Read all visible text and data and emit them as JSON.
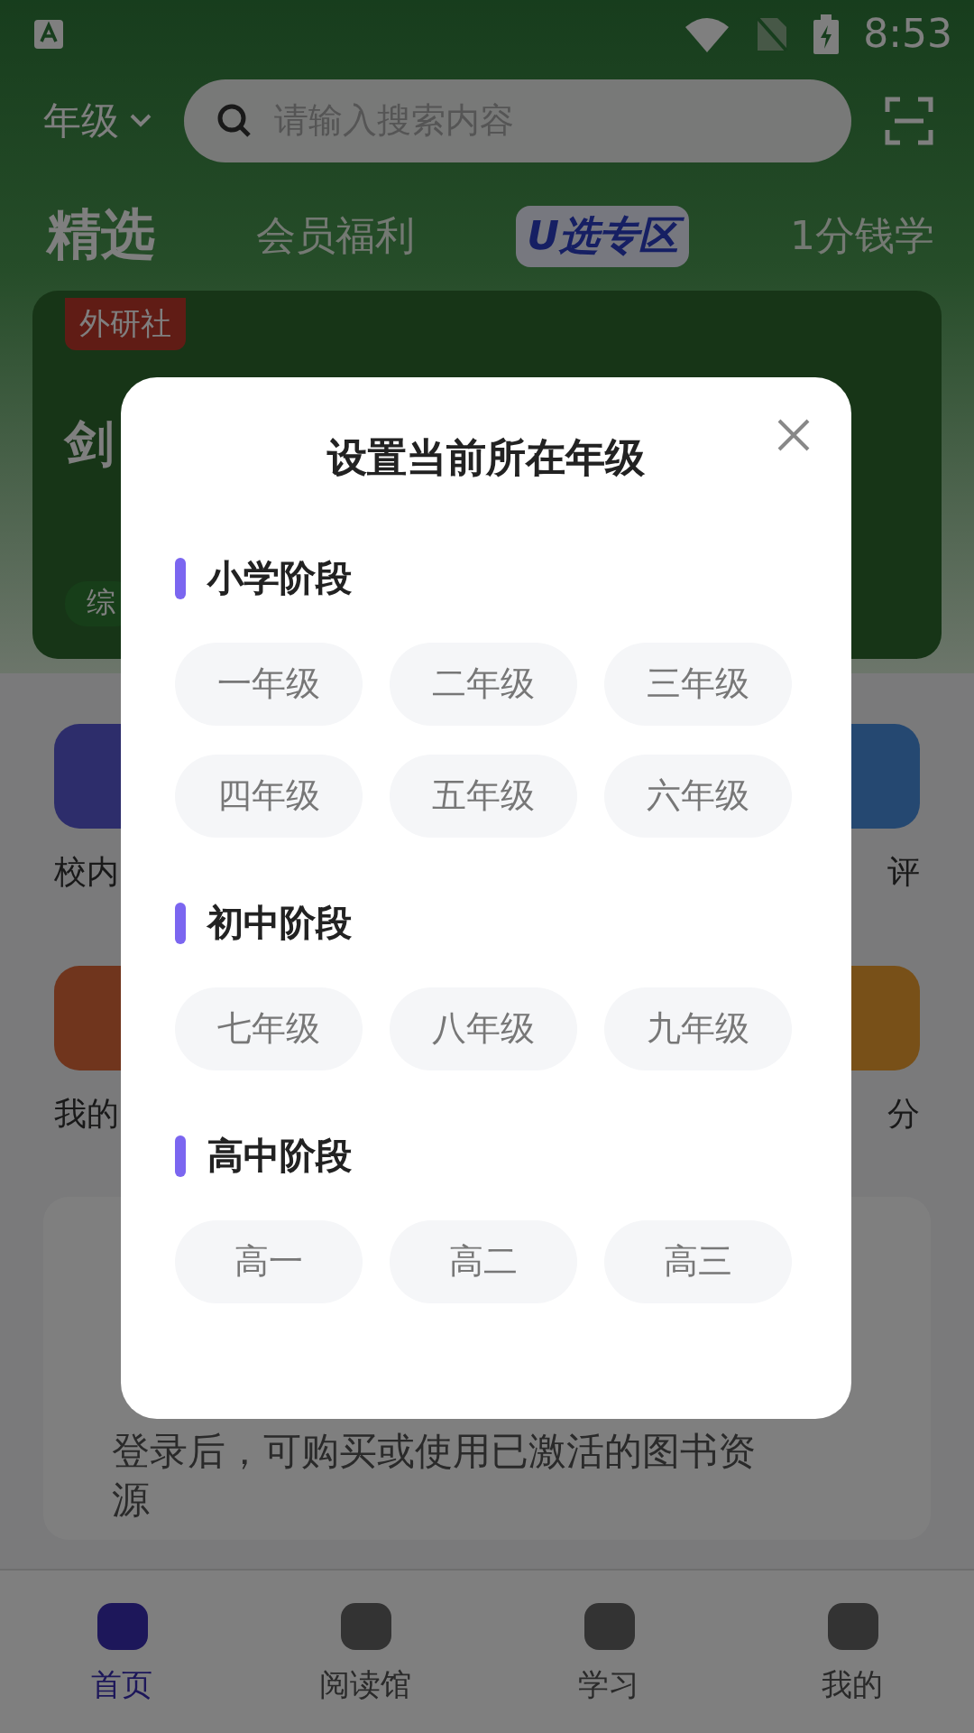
{
  "status_bar": {
    "time": "8:53"
  },
  "header": {
    "grade_selector": "年级",
    "search": {
      "placeholder": "请输入搜索内容"
    }
  },
  "tabs": [
    {
      "label": "精选",
      "selected": true,
      "kind": "text"
    },
    {
      "label": "会员福利",
      "selected": false,
      "kind": "text"
    },
    {
      "label": "U选专区",
      "selected": false,
      "kind": "logo"
    },
    {
      "label": "1分钱学",
      "selected": false,
      "kind": "text"
    }
  ],
  "banner": {
    "badge": "外研社",
    "title_fragment": "剑",
    "tag_fragment": "综"
  },
  "shortcuts": [
    {
      "label": "校内"
    },
    {
      "label": "评"
    },
    {
      "label": "我的"
    },
    {
      "label": "分"
    }
  ],
  "login_card": {
    "message": "登录后，可购买或使用已激活的图书资源"
  },
  "bottom_nav": [
    {
      "label": "首页",
      "selected": true
    },
    {
      "label": "阅读馆",
      "selected": false
    },
    {
      "label": "学习",
      "selected": false
    },
    {
      "label": "我的",
      "selected": false
    }
  ],
  "dialog": {
    "title": "设置当前所在年级",
    "sections": [
      {
        "title": "小学阶段",
        "grades": [
          "一年级",
          "二年级",
          "三年级",
          "四年级",
          "五年级",
          "六年级"
        ]
      },
      {
        "title": "初中阶段",
        "grades": [
          "七年级",
          "八年级",
          "九年级"
        ]
      },
      {
        "title": "高中阶段",
        "grades": [
          "高一",
          "高二",
          "高三"
        ]
      }
    ]
  }
}
